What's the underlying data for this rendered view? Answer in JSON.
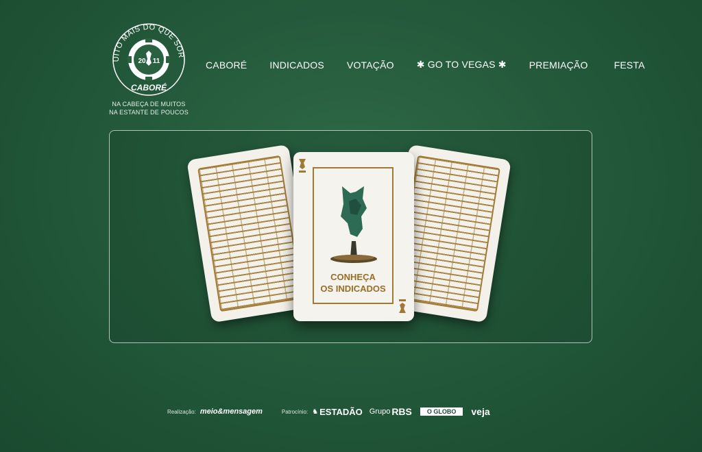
{
  "logo": {
    "ring_text": "MUITO MAIS DO QUE SORTE",
    "year_left": "20",
    "year_right": "11",
    "brand": "CABORÉ",
    "tagline_line1": "NA CABEÇA DE MUITOS",
    "tagline_line2": "NA ESTANTE DE POUCOS"
  },
  "nav": {
    "items": [
      "CABORÉ",
      "INDICADOS",
      "VOTAÇÃO",
      "✱ GO TO VEGAS ✱",
      "PREMIAÇÃO",
      "FESTA"
    ]
  },
  "hero": {
    "cta_line1": "CONHEÇA",
    "cta_line2": "OS INDICADOS"
  },
  "footer": {
    "realizacao_label": "Realização:",
    "realizacao_logo": "meio&mensagem",
    "patrocinio_label": "Patrocínio:",
    "sponsor_estadao": "ESTADÃO",
    "sponsor_rbs_prefix": "Grupo",
    "sponsor_rbs": "RBS",
    "sponsor_oglobo": "O GLOBO",
    "sponsor_veja": "veja"
  },
  "colors": {
    "background": "#245a3b",
    "gold": "#a07a35",
    "card": "#f4f3ee"
  }
}
